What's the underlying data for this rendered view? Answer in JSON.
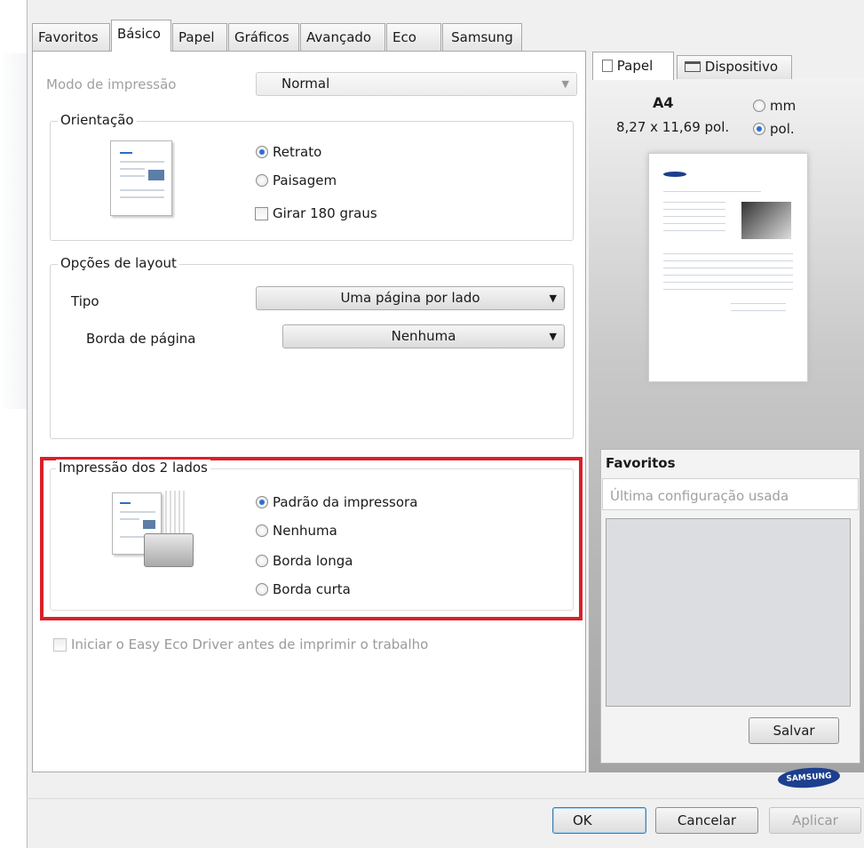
{
  "tabs": [
    "Favoritos",
    "Básico",
    "Papel",
    "Gráficos",
    "Avançado",
    "Eco",
    "Samsung"
  ],
  "mode": {
    "label": "Modo de impressão",
    "value": "Normal"
  },
  "orientation": {
    "title": "Orientação",
    "portrait": "Retrato",
    "landscape": "Paisagem",
    "rotate": "Girar 180 graus"
  },
  "layout": {
    "title": "Opções de layout",
    "type_label": "Tipo",
    "type_value": "Uma página por lado",
    "border_label": "Borda de página",
    "border_value": "Nenhuma"
  },
  "duplex": {
    "title": "Impressão dos 2 lados",
    "opt1": "Padrão da impressora",
    "opt2": "Nenhuma",
    "opt3": "Borda longa",
    "opt4": "Borda curta"
  },
  "eco": {
    "label": "Iniciar o Easy Eco Driver antes de imprimir o trabalho"
  },
  "right": {
    "tab_paper": "Papel",
    "tab_device": "Dispositivo",
    "size": "A4",
    "dims": "8,27 x 11,69 pol.",
    "mm": "mm",
    "pol": "pol."
  },
  "favorites": {
    "title": "Favoritos",
    "placeholder": "Última configuração usada",
    "save": "Salvar"
  },
  "brand": "SAMSUNG",
  "footer": {
    "ok": "OK",
    "cancel": "Cancelar",
    "apply": "Aplicar"
  },
  "colors": {
    "highlight": "#d9202a",
    "radio_on": "#2a6fd3"
  }
}
